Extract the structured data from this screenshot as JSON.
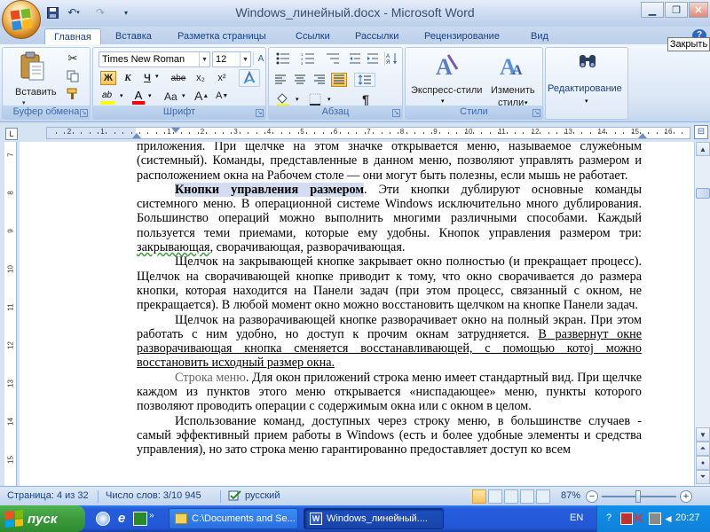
{
  "window": {
    "title": "Windows_линейный.docx - Microsoft Word",
    "tooltip": "Закрыть"
  },
  "tabs": [
    "Главная",
    "Вставка",
    "Разметка страницы",
    "Ссылки",
    "Рассылки",
    "Рецензирование",
    "Вид"
  ],
  "ribbon": {
    "clipboard": {
      "paste_label": "Вставить",
      "group_label": "Буфер обмена"
    },
    "font": {
      "font_name": "Times New Roman",
      "font_size": "12",
      "bold": "Ж",
      "italic": "К",
      "underline": "Ч",
      "strike": "abe",
      "subscript": "x₂",
      "superscript": "x²",
      "case": "Aa",
      "grow": "A",
      "shrink": "A",
      "group_label": "Шрифт"
    },
    "paragraph": {
      "pilcrow": "¶",
      "group_label": "Абзац"
    },
    "styles": {
      "express_label": "Экспресс-стили",
      "change_label_1": "Изменить",
      "change_label_2": "стили",
      "group_label": "Стили"
    },
    "editing": {
      "label": "Редактирование"
    }
  },
  "ruler": {
    "ticks": [
      "3",
      "2",
      "1",
      "1",
      "2",
      "3",
      "4",
      "5",
      "6",
      "7",
      "8",
      "9",
      "10",
      "11",
      "12",
      "13",
      "14",
      "15",
      "16",
      "17"
    ],
    "vertical_ticks": [
      "7",
      "8",
      "9",
      "10",
      "11",
      "12",
      "13",
      "14",
      "15"
    ]
  },
  "document": {
    "p1": "приложения. При щелчке на этом значке открывается меню, называемое служебным (системный). Команды, представленные в данном меню, позволяют управлять размером и расположением окна на Рабочем столе — они могут быть полезны, если мышь не работает.",
    "p2_bold": "Кнопки управления размером",
    "p2_rest": ". Эти кнопки дублируют основные команды системного меню. В операционной системе Windows исключительно много дублирования. Большинство операций можно выполнить многими различными способами. Каждый пользуется теми приемами, которые ему удобны. Кнопок управления размером три:",
    "p2_wavy": "закрывающая",
    "p2_end": ", сворачивающая, разворачивающая.",
    "p3": "Щелчок на закрывающей кнопке закрывает окно полностью (и прекращает процесс). Щелчок на сворачивающей кнопке приводит к тому, что окно сворачивается до размера кнопки, которая находится на Панели задач (при этом процесс, связанный с окном, не прекращается). В любой момент окно можно восстановить щелчком на кнопке Панели задач.",
    "p4_a": "Щелчок на разворачивающей кнопке разворачивает окно на полный экран. При этом работать с ним удобно, но доступ к прочим окнам затрудняется. ",
    "p4_b": "В развернут окне разворачивающая кнопка сменяется восстанавливающей, с помощью котоj можно восстановить исходный размер окна.",
    "p5_gray": "Строка меню",
    "p5_rest": ". Для окон приложений строка меню имеет стандартный вид. При щелчке каждом из пунктов этого меню открывается «ниспадающее» меню, пункты которого позволяют проводить операции с содержимым окна или с окном в целом.",
    "p6": "Использование команд, доступных через строку меню, в большинстве случаев - самый эффективный прием работы в Windows (есть и более удобные элементы и средства управления), но зато строка меню гарантированно предоставляет доступ ко всем"
  },
  "status": {
    "page": "Страница: 4 из 32",
    "words": "Число слов: 3/10 945",
    "language": "русский",
    "zoom": "87%",
    "zoom_minus": "−",
    "zoom_plus": "+"
  },
  "taskbar": {
    "start": "пуск",
    "task1": "C:\\Documents and Se...",
    "task2": "Windows_линейный....",
    "lang": "EN",
    "clock": "20:27"
  },
  "colors": {
    "accent": "#15428b",
    "ribbon": "#dbe7f5",
    "taskbar": "#245edb",
    "start": "#3c9a3c"
  }
}
